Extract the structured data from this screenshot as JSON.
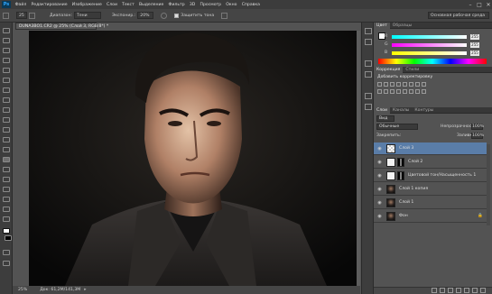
{
  "app": {
    "logo": "Ps"
  },
  "menu": [
    "Файл",
    "Редактирование",
    "Изображение",
    "Слои",
    "Текст",
    "Выделение",
    "Фильтр",
    "3D",
    "Просмотр",
    "Окно",
    "Справка"
  ],
  "options": {
    "style_label": "Диапазон:",
    "style_value": "Тени",
    "exposure_label": "Экспонир.:",
    "exposure_value": "20%",
    "protect_label": "Защитить тона",
    "workspace": "Основная рабочая среда"
  },
  "document": {
    "tab_title": "DUNA3BO1.CR2 @ 25% (Слой 3, RGB/8*) *",
    "zoom": "25%",
    "doc_size": "Док: 61,2M/141,3M"
  },
  "color_panel": {
    "tabs": [
      "Цвет",
      "Образцы"
    ],
    "sliders": [
      {
        "label": "R",
        "value": "255",
        "gradient": "linear-gradient(90deg,#00ffff,#ffffff)"
      },
      {
        "label": "G",
        "value": "255",
        "gradient": "linear-gradient(90deg,#ff00ff,#ffffff)"
      },
      {
        "label": "B",
        "value": "255",
        "gradient": "linear-gradient(90deg,#ffff00,#ffffff)"
      }
    ]
  },
  "adjust_panel": {
    "tabs": [
      "Коррекция",
      "Стили"
    ],
    "heading": "Добавить корректировку"
  },
  "layers_panel": {
    "tabs": [
      "Слои",
      "Каналы",
      "Контуры"
    ],
    "kind": "Вид",
    "blend_mode": "Обычные",
    "opacity_label": "Непрозрачность:",
    "opacity_value": "100%",
    "lock_label": "Закрепить:",
    "fill_label": "Заливка:",
    "fill_value": "100%",
    "layers": [
      {
        "name": "Слой 3",
        "selected": true,
        "thumb": "checker",
        "mask": false
      },
      {
        "name": "Слой 2",
        "selected": false,
        "thumb": "white",
        "mask": true
      },
      {
        "name": "Цветовой тон/Насыщенность 1",
        "selected": false,
        "thumb": "white",
        "mask": true
      },
      {
        "name": "Слой 1 копия",
        "selected": false,
        "thumb": "photo",
        "mask": false
      },
      {
        "name": "Слой 1",
        "selected": false,
        "thumb": "photo",
        "mask": false
      },
      {
        "name": "Фон",
        "selected": false,
        "thumb": "photo",
        "mask": false
      }
    ]
  },
  "colors": {
    "accent": "#5a7da8",
    "bg": "#535353",
    "menubar": "#3c3c3c"
  }
}
